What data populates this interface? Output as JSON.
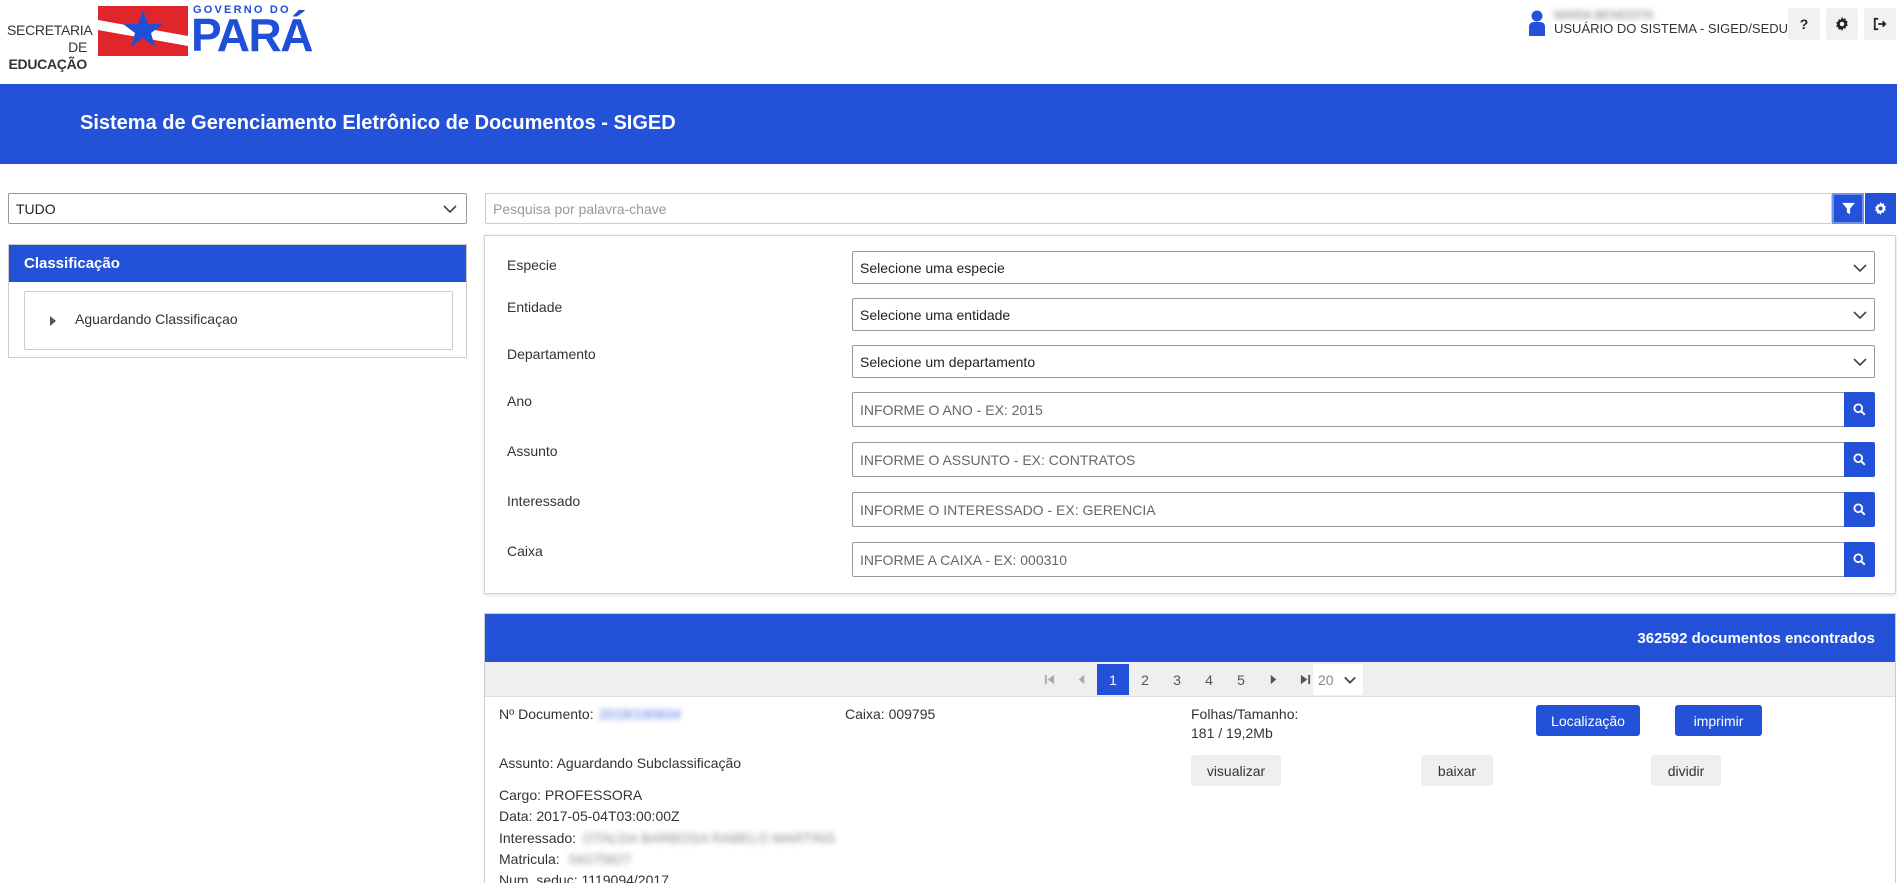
{
  "header": {
    "seduc_line1": "SECRETARIA DE",
    "seduc_line2": "EDUCAÇÃO",
    "gov_top": "GOVERNO DO",
    "gov_bottom": "PARÁ",
    "user_name": "MARIA BENEDITA",
    "user_role": "USUÁRIO DO SISTEMA - SIGED/SEDUC",
    "help_label": "?",
    "icons": [
      "user-icon",
      "gear-icon",
      "logout-icon"
    ]
  },
  "banner": {
    "title": "Sistema de Gerenciamento Eletrônico de Documentos - SIGED"
  },
  "left": {
    "scope_value": "TUDO",
    "classification_title": "Classificação",
    "tree_item": "Aguardando Classificaçao"
  },
  "search": {
    "placeholder": "Pesquisa por palavra-chave"
  },
  "filters": {
    "especie_label": "Especie",
    "especie_value": "Selecione uma especie",
    "entidade_label": "Entidade",
    "entidade_value": "Selecione uma entidade",
    "departamento_label": "Departamento",
    "departamento_value": "Selecione um departamento",
    "ano_label": "Ano",
    "ano_placeholder": "INFORME O ANO - EX: 2015",
    "assunto_label": "Assunto",
    "assunto_placeholder": "INFORME O ASSUNTO - EX: CONTRATOS",
    "interessado_label": "Interessado",
    "interessado_placeholder": "INFORME O INTERESSADO - EX: GERENCIA",
    "caixa_label": "Caixa",
    "caixa_placeholder": "INFORME A CAIXA - EX: 000310"
  },
  "results": {
    "count_text": "362592 documentos encontrados",
    "pages": [
      "1",
      "2",
      "3",
      "4",
      "5"
    ],
    "active_page": "1",
    "page_size": "20",
    "doc": {
      "numero_label": "Nº Documento:",
      "numero_value": "2018/190834",
      "caixa": "Caixa: 009795",
      "folhas_label": "Folhas/Tamanho:",
      "folhas_value": "181 / 19,2Mb",
      "assunto": "Assunto: Aguardando Subclassificação",
      "cargo": "Cargo: PROFESSORA",
      "data": "Data: 2017-05-04T03:00:00Z",
      "interessado_label": "Interessado:",
      "interessado_value": "OTALDA BARBOSA RABELO MARTINS",
      "matricula_label": "Matricula:",
      "matricula_value": "54275627",
      "num_seduc": "Num_seduc: 1119094/2017",
      "btn_localizacao": "Localização",
      "btn_imprimir": "imprimir",
      "btn_visualizar": "visualizar",
      "btn_baixar": "baixar",
      "btn_dividir": "dividir"
    }
  },
  "colors": {
    "primary": "#2352d8",
    "logo_red": "#e0262b",
    "logo_blue": "#1f4fd6"
  }
}
